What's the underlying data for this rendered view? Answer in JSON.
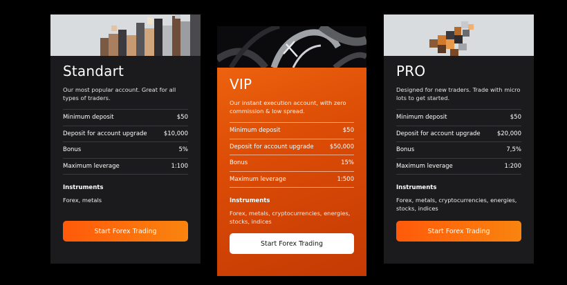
{
  "cards": [
    {
      "title": "Standart",
      "description": "Our most popular account. Great for all types of traders.",
      "rows": [
        {
          "label": "Minimum deposit",
          "value": "$50"
        },
        {
          "label": "Deposit for account upgrade",
          "value": "$10,000"
        },
        {
          "label": "Bonus",
          "value": "5%"
        },
        {
          "label": "Maximum leverage",
          "value": "1:100"
        }
      ],
      "instruments_title": "Instruments",
      "instruments": "Forex, metals",
      "button": "Start Forex Trading"
    },
    {
      "title": "VIP",
      "description": "Our instant execution account, with zero commission & low spread.",
      "rows": [
        {
          "label": "Minimum deposit",
          "value": "$50"
        },
        {
          "label": "Deposit for account upgrade",
          "value": "$50,000"
        },
        {
          "label": "Bonus",
          "value": "15%"
        },
        {
          "label": "Maximum leverage",
          "value": "1:500"
        }
      ],
      "instruments_title": "Instruments",
      "instruments": "Forex, metals, cryptocurrencies, energies, stocks, indices",
      "button": "Start Forex Trading"
    },
    {
      "title": "PRO",
      "description": "Designed for new traders. Trade with micro lots to get started.",
      "rows": [
        {
          "label": "Minimum deposit",
          "value": "$50"
        },
        {
          "label": "Deposit for account upgrade",
          "value": "$20,000"
        },
        {
          "label": "Bonus",
          "value": "7,5%"
        },
        {
          "label": "Maximum leverage",
          "value": "1:200"
        }
      ],
      "instruments_title": "Instruments",
      "instruments": "Forex, metals, cryptocurrencies, energies, stocks, indices",
      "button": "Start Forex Trading"
    }
  ],
  "colors": {
    "background": "#000000",
    "card_dark": "#1b1b1d",
    "accent_orange": "#f36c12",
    "button_gradient_start": "#ff5a0a",
    "button_gradient_end": "#f9840f"
  },
  "icons": [
    "cubes-banner-image",
    "abstract-3d-banner-image"
  ]
}
